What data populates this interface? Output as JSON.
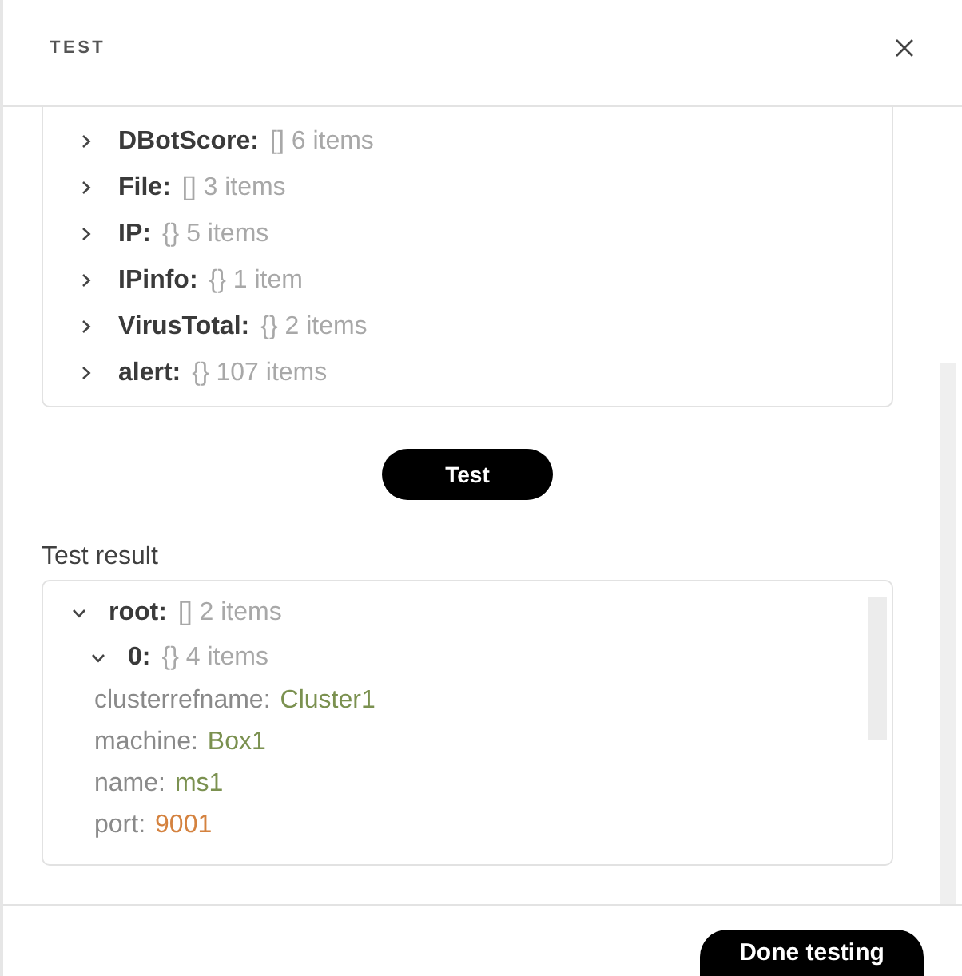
{
  "header": {
    "title": "TEST"
  },
  "input_tree": {
    "rows": [
      {
        "key": "DBotScore:",
        "summary": "[] 6 items",
        "expanded": false
      },
      {
        "key": "File:",
        "summary": "[] 3 items",
        "expanded": false
      },
      {
        "key": "IP:",
        "summary": "{} 5 items",
        "expanded": false
      },
      {
        "key": "IPinfo:",
        "summary": "{} 1 item",
        "expanded": false
      },
      {
        "key": "VirusTotal:",
        "summary": "{} 2 items",
        "expanded": false
      },
      {
        "key": "alert:",
        "summary": "{} 107 items",
        "expanded": false
      }
    ]
  },
  "test_button": {
    "label": "Test"
  },
  "result": {
    "label": "Test result",
    "tree": [
      {
        "kind": "node",
        "key": "root:",
        "summary": "[] 2 items",
        "expanded": true,
        "children": [
          {
            "kind": "node",
            "key": "0:",
            "summary": "{} 4 items",
            "expanded": true,
            "children": [
              {
                "kind": "string",
                "key": "clusterrefname:",
                "value": "Cluster1"
              },
              {
                "kind": "string",
                "key": "machine:",
                "value": "Box1"
              },
              {
                "kind": "string",
                "key": "name:",
                "value": "ms1"
              },
              {
                "kind": "number",
                "key": "port:",
                "value": "9001"
              }
            ]
          }
        ]
      }
    ]
  },
  "footer": {
    "done_button": {
      "label": "Done testing"
    }
  }
}
